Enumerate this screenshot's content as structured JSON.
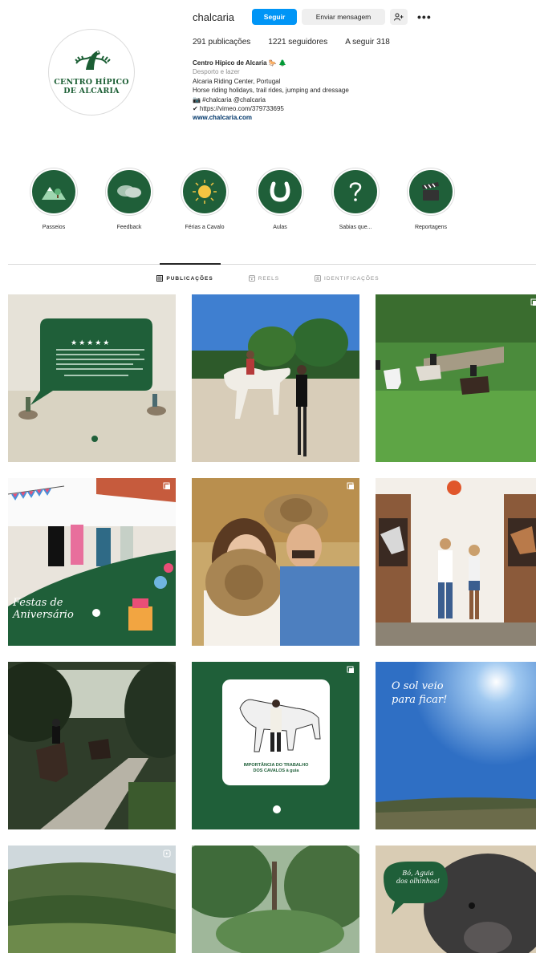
{
  "profile": {
    "username": "chalcaria",
    "follow_label": "Seguir",
    "message_label": "Enviar mensagem",
    "more_label": "•••",
    "avatar_line1": "CENTRO HÍPICO",
    "avatar_line2": "DE ALCARIA",
    "stats": {
      "posts": "291 publicações",
      "followers": "1221 seguidores",
      "following": "A seguir 318"
    },
    "bio": {
      "name": "Centro Hípico de Alcaria 🐎 🌲",
      "category": "Desporto e lazer",
      "line1": "Alcaria Riding Center, Portugal",
      "line2": "Horse riding holidays, trail rides, jumping and dressage",
      "line3": "📷 #chalcaria @chalcaria",
      "line4": "✔ https://vimeo.com/379733695",
      "website": "www.chalcaria.com"
    }
  },
  "highlights": [
    {
      "label": "Passeios",
      "icon": "mountains-icon"
    },
    {
      "label": "Feedback",
      "icon": "speech-bubbles-icon"
    },
    {
      "label": "Férias a Cavalo",
      "icon": "sun-icon"
    },
    {
      "label": "Aulas",
      "icon": "horseshoe-icon"
    },
    {
      "label": "Sabias que...",
      "icon": "question-mark-icon"
    },
    {
      "label": "Reportagens",
      "icon": "clapperboard-icon"
    }
  ],
  "tabs": [
    {
      "label": "PUBLICAÇÕES",
      "icon": "grid-icon",
      "active": true
    },
    {
      "label": "REELS",
      "icon": "reels-icon",
      "active": false
    },
    {
      "label": "IDENTIFICAÇÕES",
      "icon": "tagged-icon",
      "active": false
    }
  ],
  "posts": {
    "review_stars": "★★★★★",
    "anniversary_text": "Festas de Aniversário",
    "card_title_line1": "IMPORTÂNCIA DO TRABALHO",
    "card_title_line2": "DOS CAVALOS à guia",
    "sun_text_line1": "O sol veio",
    "sun_text_line2": "para ficar!",
    "pig_text_line1": "Bó, Aguia",
    "pig_text_line2": "dos olhinhos!"
  },
  "colors": {
    "brand_green": "#1f5f39",
    "follow_blue": "#0095f6"
  }
}
